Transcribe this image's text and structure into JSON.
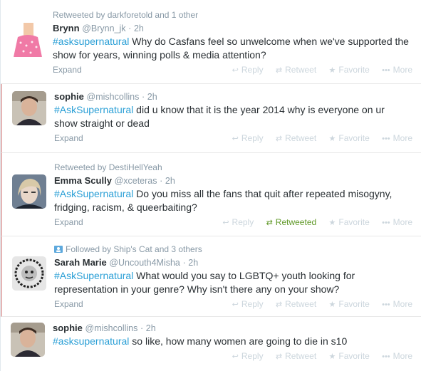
{
  "tweets": [
    {
      "context": "Retweeted by darkforetold and 1 other",
      "name": "Brynn",
      "username": "@Brynn_jk",
      "time": "2h",
      "hashtag": "#asksupernatural",
      "text": "  Why do Casfans feel so unwelcome when we've supported the show for years, winning polls & media attention?",
      "expand": "Expand",
      "actions": [
        "Reply",
        "Retweet",
        "Favorite",
        "More"
      ]
    },
    {
      "context": "",
      "name": "sophie",
      "username": "@mishcollins",
      "time": "2h",
      "hashtag": "#AskSupernatural",
      "text": " did u know that it is the year 2014 why is everyone on ur show straight or dead",
      "expand": "Expand",
      "actions": [
        "Reply",
        "Retweet",
        "Favorite",
        "More"
      ]
    },
    {
      "context": "Retweeted by DestiHellYeah",
      "name": "Emma Scully",
      "username": "@xceteras",
      "time": "2h",
      "hashtag": "#AskSupernatural",
      "text": " Do you miss all the fans that quit after repeated misogyny, fridging, racism, & queerbaiting?",
      "expand": "Expand",
      "actions": [
        "Reply",
        "Retweeted",
        "Favorite",
        "More"
      ]
    },
    {
      "context": "Followed by Ship's Cat and 3 others",
      "name": "Sarah Marie",
      "username": "@Uncouth4Misha",
      "time": "2h",
      "hashtag": "#AskSupernatural",
      "text": " What would you say to LGBTQ+ youth looking for representation in your genre? Why isn't there any on your show?",
      "expand": "Expand",
      "actions": [
        "Reply",
        "Retweet",
        "Favorite",
        "More"
      ]
    },
    {
      "context": "",
      "name": "sophie",
      "username": "@mishcollins",
      "time": "2h",
      "hashtag": "#asksupernatural",
      "text": " so like, how many women are going to die in s10",
      "expand": "",
      "actions": [
        "Reply",
        "Retweet",
        "Favorite",
        "More"
      ]
    }
  ],
  "colors": {
    "hashtag": "#2a9fd6",
    "retweeted": "#609928",
    "muted": "#8899a6",
    "action": "#ccd6dd"
  },
  "icons": {
    "reply": "reply-icon",
    "retweet": "retweet-icon",
    "favorite": "star-icon",
    "more": "more-dots-icon",
    "followed": "person-icon"
  }
}
